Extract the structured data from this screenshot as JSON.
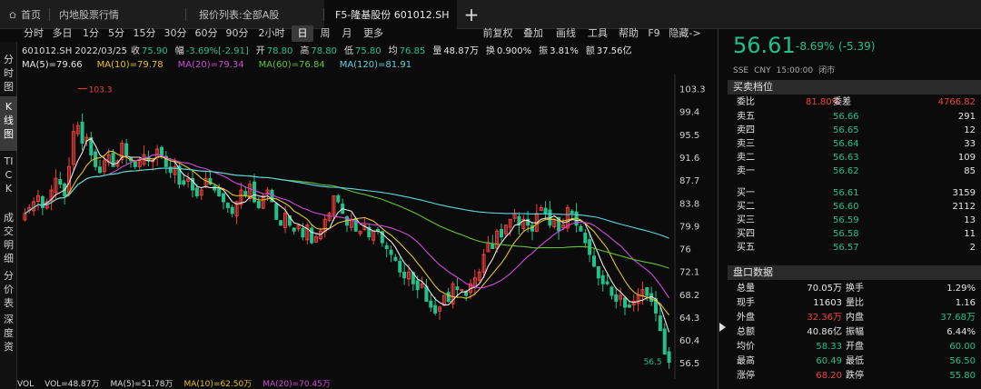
{
  "tabs": [
    {
      "label": "首页",
      "active": false
    },
    {
      "label": "内地股票行情",
      "active": false
    },
    {
      "label": "报价列表:全部A股",
      "active": false
    },
    {
      "label": "F5-隆基股份 601012.SH",
      "active": true
    }
  ],
  "toolbar": {
    "periods": [
      "分时",
      "多日",
      "1分",
      "5分",
      "15分",
      "30分",
      "60分",
      "90分",
      "2小时",
      "日",
      "周",
      "月",
      "更多"
    ],
    "selected_period": "日",
    "actions": [
      "前复权",
      "叠加",
      "画线",
      "工具",
      "帮助",
      "F9",
      "隐藏->"
    ]
  },
  "side_tabs": [
    "分时图",
    "K线图",
    "TICK",
    "成交明细",
    "分价表",
    "深度资"
  ],
  "side_selected": "K线图",
  "info": {
    "code_date": "601012.SH 2022/03/25",
    "fields": [
      {
        "label": "收",
        "value": "75.90",
        "color": "#22c08b"
      },
      {
        "label": "幅",
        "value": "-3.69%[-2.91]",
        "color": "#22c08b"
      },
      {
        "label": "开",
        "value": "78.80",
        "color": "#22c08b"
      },
      {
        "label": "高",
        "value": "78.80",
        "color": "#22c08b"
      },
      {
        "label": "低",
        "value": "75.80",
        "color": "#22c08b"
      },
      {
        "label": "均",
        "value": "76.85",
        "color": "#22c08b"
      },
      {
        "label": "量",
        "value": "48.87万",
        "color": "#e6e6e6"
      },
      {
        "label": "换",
        "value": "0.900%",
        "color": "#e6e6e6"
      },
      {
        "label": "振",
        "value": "3.81%",
        "color": "#e6e6e6"
      },
      {
        "label": "额",
        "value": "37.56亿",
        "color": "#e6e6e6"
      }
    ]
  },
  "ma_legend": [
    {
      "label": "MA(5)=79.66",
      "color": "#e8e8e8"
    },
    {
      "label": "MA(10)=79.78",
      "color": "#e6c229"
    },
    {
      "label": "MA(20)=79.34",
      "color": "#d04ad8"
    },
    {
      "label": "MA(60)=76.84",
      "color": "#62c23a"
    },
    {
      "label": "MA(120)=81.91",
      "color": "#5fd3e0"
    }
  ],
  "chart_data": {
    "type": "candlestick",
    "y_ticks": [
      "103.3",
      "99.4",
      "95.5",
      "91.6",
      "87.7",
      "83.8",
      "79.9",
      "76",
      "72.1",
      "68.2",
      "64.3",
      "60.4",
      "56.5"
    ],
    "ylim": [
      55.6,
      105.1
    ],
    "annotations": [
      {
        "label": "103.3"
      },
      {
        "label": "56.5"
      }
    ],
    "up_color": "#f0403c",
    "down_color": "#22c08b",
    "closes": [
      82,
      83,
      84,
      85,
      83,
      84,
      86,
      88,
      87,
      85,
      90,
      96,
      97,
      94,
      95,
      92,
      90,
      89,
      91,
      92,
      90,
      91,
      94,
      92,
      91,
      90,
      91,
      92,
      91,
      91,
      93,
      92,
      90,
      89,
      90,
      87,
      87,
      88,
      86,
      85,
      86,
      88,
      87,
      86,
      85,
      84,
      83,
      82,
      84,
      86,
      85,
      87,
      84,
      83,
      85,
      86,
      84,
      81,
      80,
      82,
      80,
      79,
      80,
      78,
      80,
      77,
      78,
      79,
      81,
      82,
      85,
      84,
      82,
      80,
      81,
      79,
      79,
      80,
      78,
      79,
      79,
      77,
      76,
      75,
      74,
      72,
      71,
      72,
      70,
      69,
      70,
      67,
      66,
      65,
      66,
      68,
      67,
      70,
      69,
      69,
      68,
      70,
      71,
      72,
      75,
      77,
      76,
      79,
      78,
      80,
      81,
      82,
      80,
      81,
      80,
      79,
      82,
      83,
      82,
      80,
      81,
      79,
      80,
      83,
      82,
      80,
      79,
      77,
      75,
      73,
      71,
      70,
      70,
      68,
      67,
      68,
      66,
      66,
      67,
      68,
      69,
      68,
      67,
      65,
      62,
      58,
      56.61
    ],
    "ma_lines": [
      "MA5",
      "MA10",
      "MA20",
      "MA60",
      "MA120"
    ]
  },
  "bottom_row": [
    {
      "label": "VOL",
      "color": "#dcdcdc"
    },
    {
      "label": "VOL=48.87万",
      "color": "#dcdcdc"
    },
    {
      "label": "MA(5)=51.78万",
      "color": "#dcdcdc"
    },
    {
      "label": "MA(10)=62.50万",
      "color": "#e6c229"
    },
    {
      "label": "MA(20)=70.45万",
      "color": "#d04ad8"
    }
  ],
  "right": {
    "price": "56.61",
    "change_pct": "-8.69%",
    "change": "(-5.39)",
    "exchange": "SSE",
    "currency": "CNY",
    "time": "15:00:00",
    "status": "闭市",
    "orderbook_title": "买卖档位",
    "weibi": {
      "label": "委比",
      "pct": "81.80%",
      "label2": "委差",
      "value": "4766.82"
    },
    "asks": [
      {
        "label": "卖五",
        "price": "56.66",
        "vol": "291"
      },
      {
        "label": "卖四",
        "price": "56.65",
        "vol": "12"
      },
      {
        "label": "卖三",
        "price": "56.64",
        "vol": "33"
      },
      {
        "label": "卖二",
        "price": "56.63",
        "vol": "109"
      },
      {
        "label": "卖一",
        "price": "56.62",
        "vol": "85"
      }
    ],
    "bids": [
      {
        "label": "买一",
        "price": "56.61",
        "vol": "3159"
      },
      {
        "label": "买二",
        "price": "56.60",
        "vol": "2112"
      },
      {
        "label": "买三",
        "price": "56.59",
        "vol": "13"
      },
      {
        "label": "买四",
        "price": "56.58",
        "vol": "11"
      },
      {
        "label": "买五",
        "price": "56.57",
        "vol": "2"
      }
    ],
    "stats_title": "盘口数据",
    "stats": [
      {
        "l1": "总量",
        "v1": "70.05万",
        "c1": "white",
        "l2": "换手",
        "v2": "1.29%",
        "c2": "white"
      },
      {
        "l1": "现手",
        "v1": "11603",
        "c1": "white",
        "l2": "量比",
        "v2": "1.16",
        "c2": "white"
      },
      {
        "l1": "外盘",
        "v1": "32.36万",
        "c1": "red",
        "l2": "内盘",
        "v2": "37.68万",
        "c2": "green"
      },
      {
        "l1": "总额",
        "v1": "40.86亿",
        "c1": "white",
        "l2": "振幅",
        "v2": "6.44%",
        "c2": "white"
      },
      {
        "l1": "均价",
        "v1": "58.33",
        "c1": "green",
        "l2": "开盘",
        "v2": "60.00",
        "c2": "green"
      },
      {
        "l1": "最高",
        "v1": "60.49",
        "c1": "green",
        "l2": "最低",
        "v2": "56.50",
        "c2": "green"
      },
      {
        "l1": "涨停",
        "v1": "68.20",
        "c1": "red",
        "l2": "跌停",
        "v2": "55.80",
        "c2": "green"
      }
    ]
  }
}
